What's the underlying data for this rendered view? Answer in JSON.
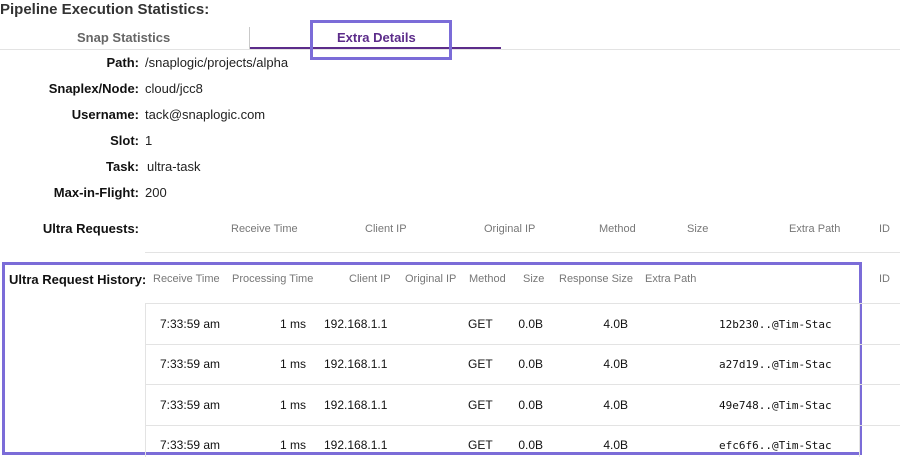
{
  "page_title": "Pipeline Execution Statistics:",
  "tabs": [
    {
      "label": "Snap Statistics",
      "active": false
    },
    {
      "label": "Extra Details",
      "active": true
    }
  ],
  "details": {
    "path": {
      "label": "Path:",
      "value": "/snaplogic/projects/alpha"
    },
    "snaplex": {
      "label": "Snaplex/Node:",
      "value": "cloud/jcc8"
    },
    "username": {
      "label": "Username:",
      "value": "tack@snaplogic.com"
    },
    "slot": {
      "label": "Slot:",
      "value": "1"
    },
    "task": {
      "label": "Task:",
      "value": "ultra-task"
    },
    "max_in_flight": {
      "label": "Max-in-Flight:",
      "value": "200"
    }
  },
  "ultra_requests": {
    "label": "Ultra Requests:",
    "columns": [
      "Receive Time",
      "Client IP",
      "Original IP",
      "Method",
      "Size",
      "Extra Path",
      "ID"
    ]
  },
  "ultra_request_history": {
    "label": "Ultra Request History:",
    "columns": [
      "Receive Time",
      "Processing Time",
      "Client IP",
      "Original IP",
      "Method",
      "Size",
      "Response Size",
      "Extra Path",
      "ID"
    ],
    "rows": [
      {
        "receive_time": "7:33:59 am",
        "processing_time": "1 ms",
        "client_ip": "192.168.1.1",
        "original_ip": "",
        "method": "GET",
        "size": "0.0B",
        "response_size": "4.0B",
        "id": "12b230..@Tim-Stac"
      },
      {
        "receive_time": "7:33:59 am",
        "processing_time": "1 ms",
        "client_ip": "192.168.1.1",
        "original_ip": "",
        "method": "GET",
        "size": "0.0B",
        "response_size": "4.0B",
        "id": "a27d19..@Tim-Stac"
      },
      {
        "receive_time": "7:33:59 am",
        "processing_time": "1 ms",
        "client_ip": "192.168.1.1",
        "original_ip": "",
        "method": "GET",
        "size": "0.0B",
        "response_size": "4.0B",
        "id": "49e748..@Tim-Stac"
      },
      {
        "receive_time": "7:33:59 am",
        "processing_time": "1 ms",
        "client_ip": "192.168.1.1",
        "original_ip": "",
        "method": "GET",
        "size": "0.0B",
        "response_size": "4.0B",
        "id": "efc6f6..@Tim-Stac"
      }
    ]
  },
  "colors": {
    "accent": "#5c2c8a",
    "highlight_border": "#7b6cd8"
  }
}
